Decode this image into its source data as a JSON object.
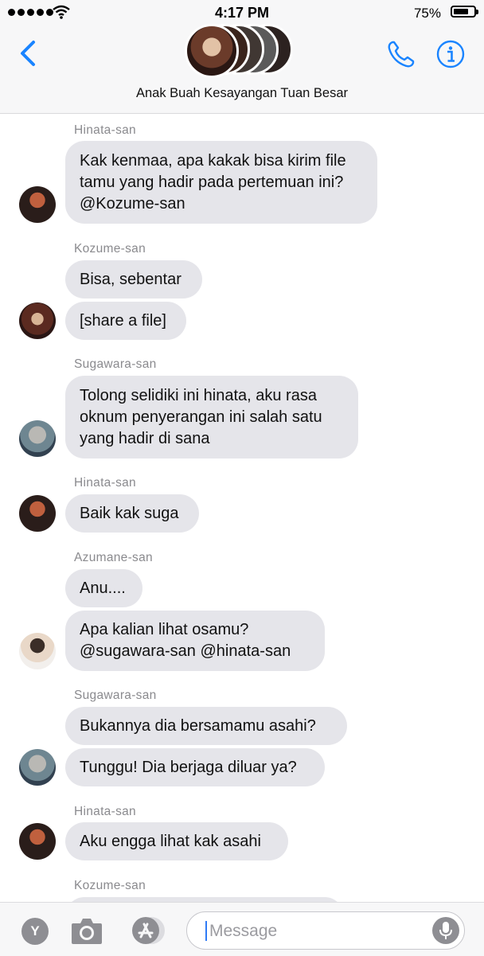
{
  "status_bar": {
    "time": "4:17 PM",
    "battery_percent": "75%",
    "battery_level": 0.75,
    "signal_bars": 5
  },
  "header": {
    "title": "Anak Buah Kesayangan Tuan Besar",
    "accent_color": "#1a84ff",
    "icons": {
      "back": "chevron-left-icon",
      "call": "phone-icon",
      "info": "info-icon"
    }
  },
  "messages": [
    {
      "sender": "Hinata-san",
      "avatar": "hinata",
      "bubbles": [
        {
          "lines": [
            "Kak kenmaa, apa kakak bisa kirim file",
            "tamu yang hadir pada pertemuan ini?",
            "@Kozume-san"
          ]
        }
      ]
    },
    {
      "sender": "Kozume-san",
      "avatar": "kozume",
      "bubbles": [
        {
          "lines": [
            "Bisa, sebentar"
          ]
        },
        {
          "lines": [
            "[share a file]"
          ]
        }
      ]
    },
    {
      "sender": "Sugawara-san",
      "avatar": "sugawara",
      "bubbles": [
        {
          "lines": [
            "Tolong selidiki ini hinata, aku rasa",
            "oknum penyerangan ini salah satu",
            "yang hadir di sana"
          ]
        }
      ]
    },
    {
      "sender": "Hinata-san",
      "avatar": "hinata",
      "bubbles": [
        {
          "lines": [
            "Baik kak suga"
          ]
        }
      ]
    },
    {
      "sender": "Azumane-san",
      "avatar": "azumane",
      "bubbles": [
        {
          "lines": [
            "Anu...."
          ]
        },
        {
          "lines": [
            "Apa kalian lihat osamu?",
            "@sugawara-san @hinata-san"
          ]
        }
      ]
    },
    {
      "sender": "Sugawara-san",
      "avatar": "sugawara",
      "bubbles": [
        {
          "lines": [
            "Bukannya dia bersamamu asahi?"
          ]
        },
        {
          "lines": [
            "Tunggu! Dia berjaga diluar ya?"
          ]
        }
      ]
    },
    {
      "sender": "Hinata-san",
      "avatar": "hinata",
      "bubbles": [
        {
          "lines": [
            "Aku engga lihat kak asahi"
          ]
        }
      ]
    },
    {
      "sender": "Kozume-san",
      "avatar": "kozume",
      "bubbles": []
    }
  ],
  "input_bar": {
    "placeholder": "Message",
    "app_button_label": "Y",
    "icons": {
      "camera": "camera-icon",
      "apps": "app-store-icon",
      "mic": "microphone-icon"
    }
  }
}
